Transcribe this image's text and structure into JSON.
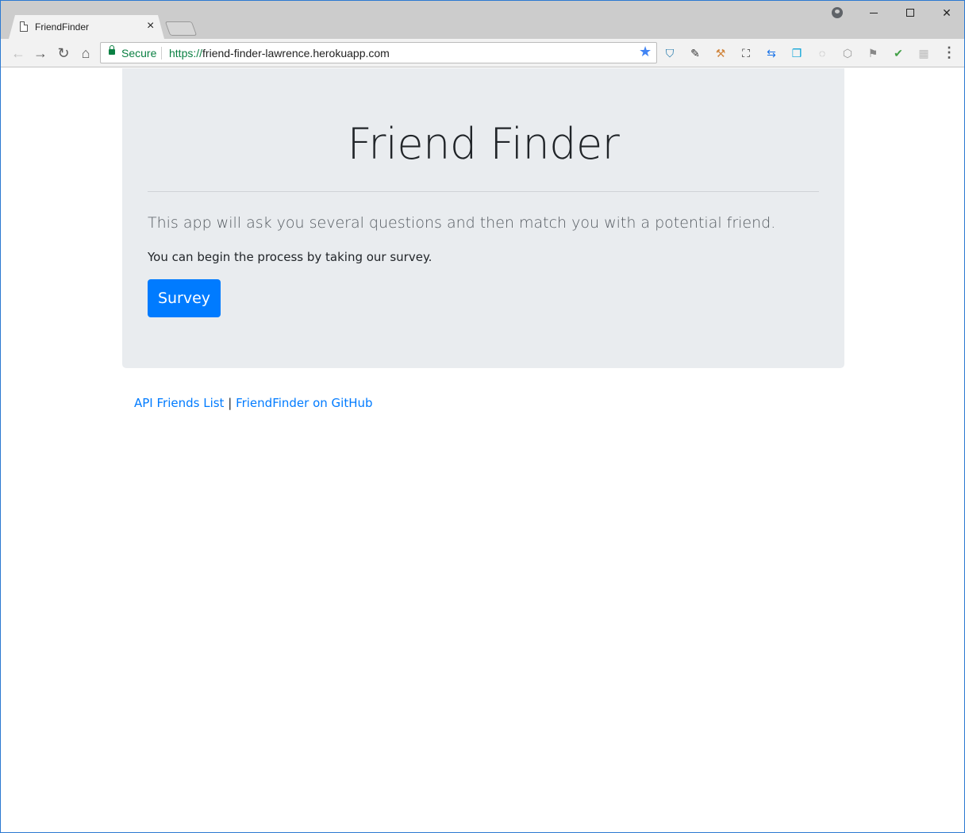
{
  "browser": {
    "tab_title": "FriendFinder",
    "tab_close": "×",
    "secure_label": "Secure",
    "url_scheme": "https://",
    "url_rest": "friend-finder-lawrence.herokuapp.com",
    "icons": {
      "back": "←",
      "forward": "→",
      "reload": "↻",
      "home": "⌂",
      "star": "★",
      "menu": "⋮"
    },
    "window_controls": {
      "close": "✕"
    },
    "extensions": [
      {
        "name": "shield-extension-icon",
        "glyph": "⛉",
        "color": "#1a73a8"
      },
      {
        "name": "eyedropper-extension-icon",
        "glyph": "✎",
        "color": "#333333"
      },
      {
        "name": "hammer-extension-icon",
        "glyph": "⚒",
        "color": "#d0843b"
      },
      {
        "name": "screenshot-extension-icon",
        "glyph": "⛶",
        "color": "#333333"
      },
      {
        "name": "arrows-extension-icon",
        "glyph": "⇆",
        "color": "#1a73e8"
      },
      {
        "name": "copy-extension-icon",
        "glyph": "❐",
        "color": "#00a0d6"
      },
      {
        "name": "braces-extension-icon",
        "glyph": "◌",
        "color": "#999999"
      },
      {
        "name": "cube-extension-icon",
        "glyph": "⬡",
        "color": "#999999"
      },
      {
        "name": "flag-extension-icon",
        "glyph": "⚑",
        "color": "#888888"
      },
      {
        "name": "check-extension-icon",
        "glyph": "✔",
        "color": "#43a047"
      },
      {
        "name": "grid-extension-icon",
        "glyph": "▦",
        "color": "#bbbbbb"
      }
    ]
  },
  "page": {
    "title": "Friend Finder",
    "lead": "This app will ask you several questions and then match you with a potential friend.",
    "intro": "You can begin the process by taking our survey.",
    "survey_button": "Survey",
    "footer": {
      "api_link": "API Friends List",
      "separator": "|",
      "github_link": "FriendFinder on GitHub"
    }
  },
  "colors": {
    "primary": "#007bff",
    "jumbotron_bg": "#e9ecef",
    "secure_green": "#0b8043"
  }
}
